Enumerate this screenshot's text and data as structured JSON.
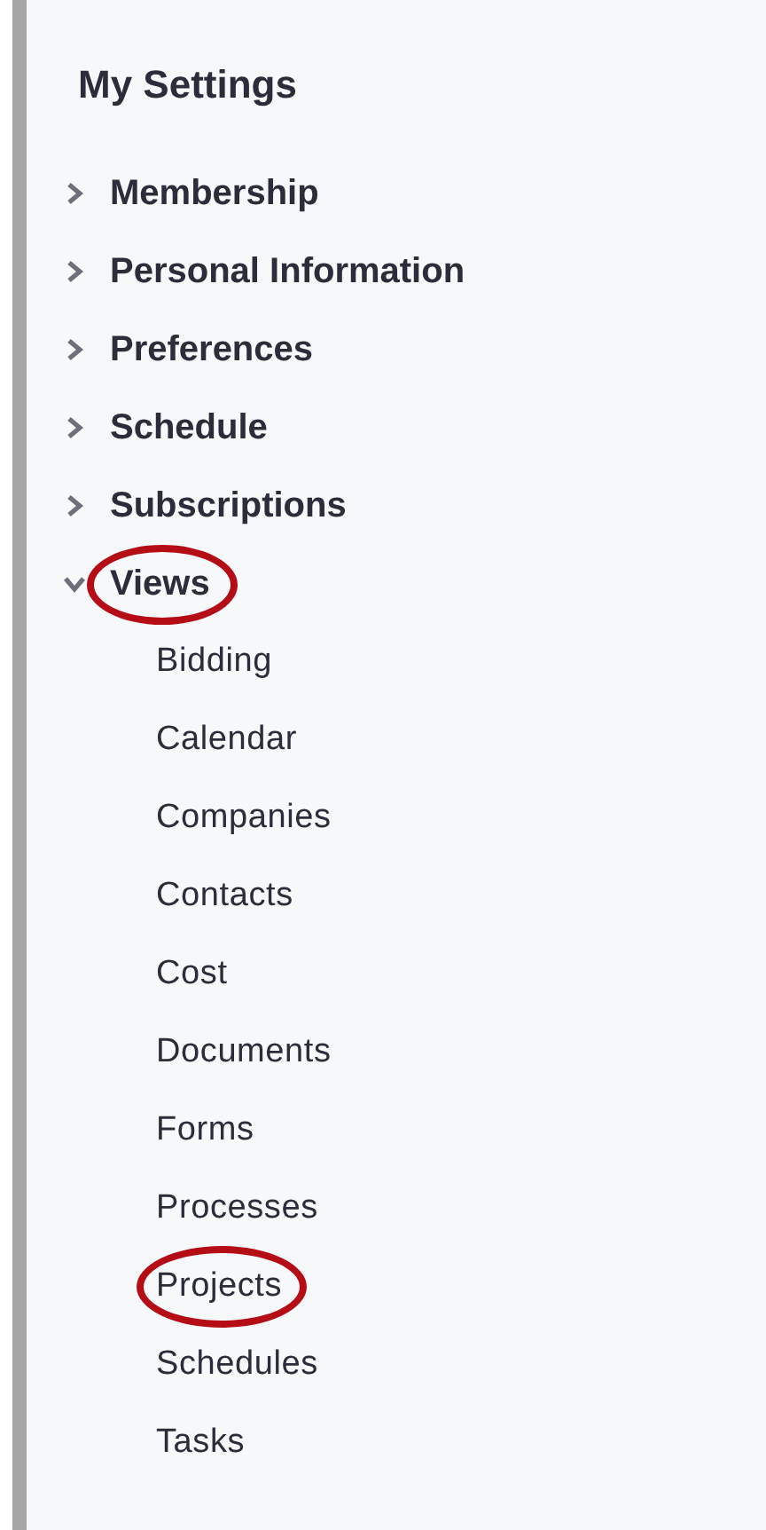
{
  "title": "My Settings",
  "items": [
    {
      "label": "Membership",
      "expanded": false,
      "circled": false
    },
    {
      "label": "Personal Information",
      "expanded": false,
      "circled": false
    },
    {
      "label": "Preferences",
      "expanded": false,
      "circled": false
    },
    {
      "label": "Schedule",
      "expanded": false,
      "circled": false
    },
    {
      "label": "Subscriptions",
      "expanded": false,
      "circled": false
    },
    {
      "label": "Views",
      "expanded": true,
      "circled": true,
      "children": [
        {
          "label": "Bidding",
          "circled": false
        },
        {
          "label": "Calendar",
          "circled": false
        },
        {
          "label": "Companies",
          "circled": false
        },
        {
          "label": "Contacts",
          "circled": false
        },
        {
          "label": "Cost",
          "circled": false
        },
        {
          "label": "Documents",
          "circled": false
        },
        {
          "label": "Forms",
          "circled": false
        },
        {
          "label": "Processes",
          "circled": false
        },
        {
          "label": "Projects",
          "circled": true
        },
        {
          "label": "Schedules",
          "circled": false
        },
        {
          "label": "Tasks",
          "circled": false
        }
      ]
    }
  ]
}
